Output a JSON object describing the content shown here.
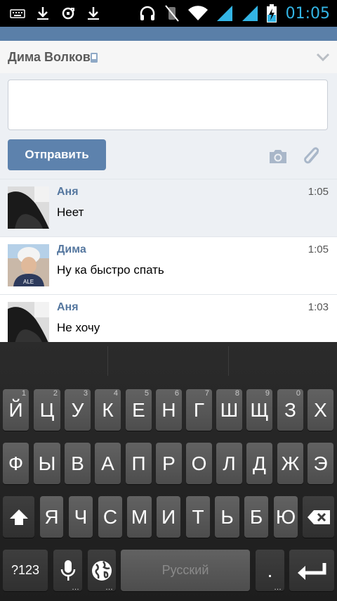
{
  "status_bar": {
    "time": "01:05",
    "icons_left": [
      "keyboard-icon",
      "download-icon",
      "sync-icon",
      "download-icon"
    ],
    "icons_right": [
      "headset-icon",
      "vibrate-off-icon",
      "wifi-icon",
      "signal-icon",
      "signal-icon",
      "battery-charging-icon"
    ],
    "time_color": "#33b5e5"
  },
  "header": {
    "title": "Дима Волков",
    "phone_icon": "phone-icon",
    "menu_icon": "chevron-down-icon"
  },
  "compose": {
    "input_value": "",
    "send_label": "Отправить",
    "camera_icon": "camera-icon",
    "attach_icon": "paperclip-icon"
  },
  "messages": [
    {
      "sender": "Аня",
      "time": "1:05",
      "text": "Неет",
      "unread": true
    },
    {
      "sender": "Дима",
      "time": "1:05",
      "text": "Ну ка быстро спать",
      "unread": false
    },
    {
      "sender": "Аня",
      "time": "1:03",
      "text": "Не хочу",
      "unread": false
    }
  ],
  "keyboard": {
    "row1": [
      {
        "label": "Й",
        "hint": "1"
      },
      {
        "label": "Ц",
        "hint": "2"
      },
      {
        "label": "У",
        "hint": "3"
      },
      {
        "label": "К",
        "hint": "4"
      },
      {
        "label": "Е",
        "hint": "5"
      },
      {
        "label": "Н",
        "hint": "6"
      },
      {
        "label": "Г",
        "hint": "7"
      },
      {
        "label": "Ш",
        "hint": "8"
      },
      {
        "label": "Щ",
        "hint": "9"
      },
      {
        "label": "З",
        "hint": "0"
      },
      {
        "label": "Х",
        "hint": ""
      }
    ],
    "row2": [
      "Ф",
      "Ы",
      "В",
      "А",
      "П",
      "Р",
      "О",
      "Л",
      "Д",
      "Ж",
      "Э"
    ],
    "row3": [
      "Я",
      "Ч",
      "С",
      "М",
      "И",
      "Т",
      "Ь",
      "Б",
      "Ю"
    ],
    "symbols_label": "?123",
    "space_label": "Русский",
    "period_label": ".",
    "shift_icon": "shift-icon",
    "backspace_icon": "backspace-icon",
    "mic_icon": "microphone-icon",
    "globe_icon": "globe-icon",
    "enter_icon": "enter-icon"
  }
}
